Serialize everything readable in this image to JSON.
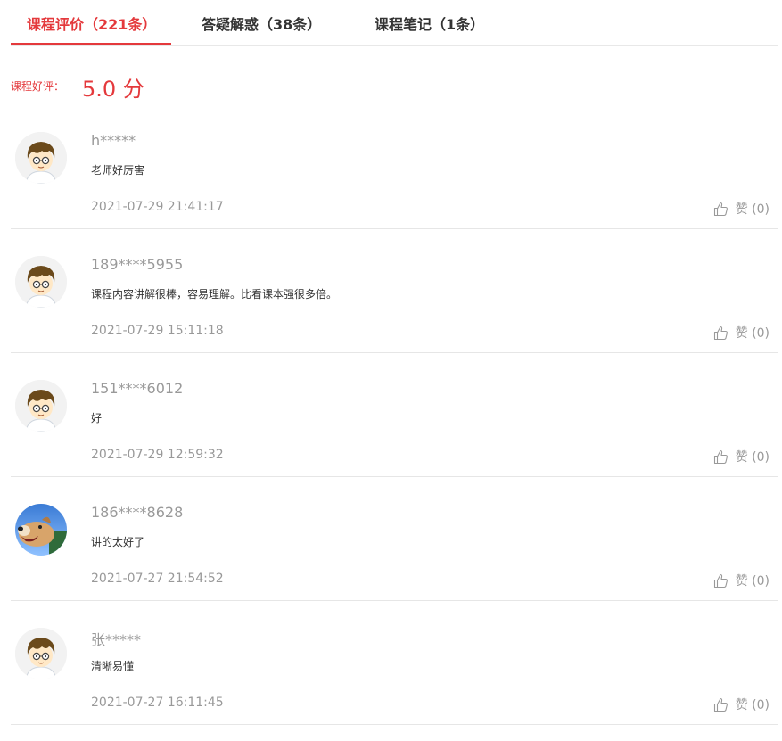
{
  "tabs": [
    {
      "label": "课程评价（221条）",
      "active": true
    },
    {
      "label": "答疑解惑（38条）",
      "active": false
    },
    {
      "label": "课程笔记（1条）",
      "active": false
    }
  ],
  "rating": {
    "label": "课程好评：",
    "score": "5.0 分"
  },
  "reviews": [
    {
      "user": "h*****",
      "comment": "老师好厉害",
      "time": "2021-07-29 21:41:17",
      "like_label": "赞",
      "like_count": "(0)",
      "avatar": "cartoon-boy-avatar"
    },
    {
      "user": "189****5955",
      "comment": "课程内容讲解很棒，容易理解。比看课本强很多倍。",
      "time": "2021-07-29 15:11:18",
      "like_label": "赞",
      "like_count": "(0)",
      "avatar": "cartoon-boy-avatar"
    },
    {
      "user": "151****6012",
      "comment": "好",
      "time": "2021-07-29 12:59:32",
      "like_label": "赞",
      "like_count": "(0)",
      "avatar": "cartoon-boy-avatar"
    },
    {
      "user": "186****8628",
      "comment": "讲的太好了",
      "time": "2021-07-27 21:54:52",
      "like_label": "赞",
      "like_count": "(0)",
      "avatar": "dog-photo-avatar"
    },
    {
      "user": "张*****",
      "comment": "清晰易懂",
      "time": "2021-07-27 16:11:45",
      "like_label": "赞",
      "like_count": "(0)",
      "avatar": "cartoon-boy-avatar"
    }
  ],
  "colors": {
    "accent": "#e4393c",
    "muted": "#999999",
    "divider": "#e6e6e6"
  }
}
